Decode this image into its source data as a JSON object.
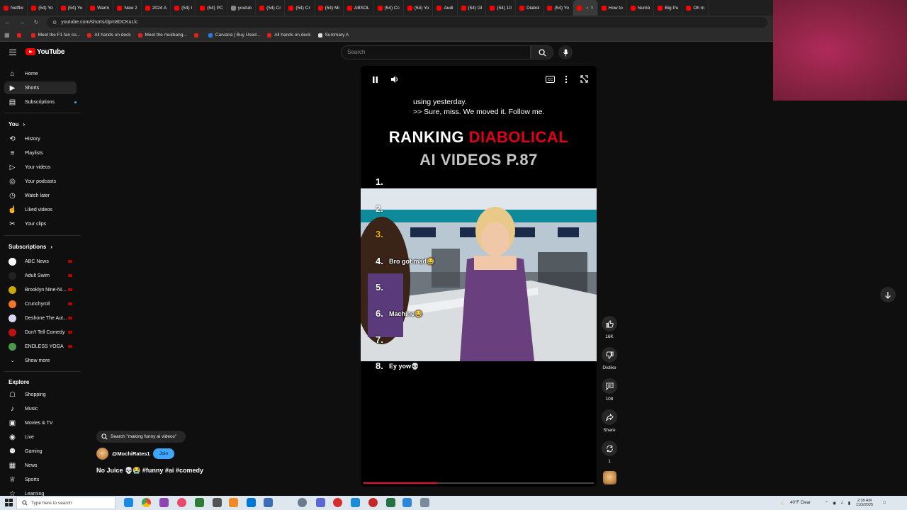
{
  "browser": {
    "tabs": [
      {
        "label": "Netflix",
        "color": "#e50914"
      },
      {
        "label": "(54) Yo",
        "color": "#ff0000"
      },
      {
        "label": "(54) Yo",
        "color": "#ff0000"
      },
      {
        "label": "Warm",
        "color": "#ff0000"
      },
      {
        "label": "New 2",
        "color": "#ff0000"
      },
      {
        "label": "2024 A",
        "color": "#ff0000"
      },
      {
        "label": "(54) I",
        "color": "#ff0000"
      },
      {
        "label": "(54) PC",
        "color": "#ff0000"
      },
      {
        "label": "youtub",
        "color": "#888888"
      },
      {
        "label": "(54) Cr",
        "color": "#ff0000"
      },
      {
        "label": "(54) Cr",
        "color": "#ff0000"
      },
      {
        "label": "(54) Mi",
        "color": "#ff0000"
      },
      {
        "label": "ABSOL",
        "color": "#ff0000"
      },
      {
        "label": "(54) Cc",
        "color": "#ff0000"
      },
      {
        "label": "(54) Yo",
        "color": "#ff0000"
      },
      {
        "label": "Audi",
        "color": "#ff0000"
      },
      {
        "label": "(54) Gl",
        "color": "#ff0000"
      },
      {
        "label": "(54) 10",
        "color": "#ff0000"
      },
      {
        "label": "Diabol",
        "color": "#ff0000"
      },
      {
        "label": "(54) Yo",
        "color": "#ff0000"
      },
      {
        "label": "",
        "color": "#ff0000",
        "active": true
      },
      {
        "label": "How to",
        "color": "#ff0000"
      },
      {
        "label": "Numb",
        "color": "#ff0000"
      },
      {
        "label": "Big Pu",
        "color": "#ff0000"
      },
      {
        "label": "Oh m",
        "color": "#ff0000"
      }
    ],
    "url": "youtube.com/shorts/dpm8DCKuLlc",
    "bookmarks": [
      {
        "label": "",
        "color": "#e62117"
      },
      {
        "label": "Meet the F1 fan co...",
        "color": "#e62117"
      },
      {
        "label": "All hands on deck",
        "color": "#e62117"
      },
      {
        "label": "Meet the mukbang...",
        "color": "#e62117"
      },
      {
        "label": "",
        "color": "#e62117"
      },
      {
        "label": "Carvana | Buy Used...",
        "color": "#2a7de1"
      },
      {
        "label": "All hands on deck",
        "color": "#e62117"
      },
      {
        "label": "Summary A",
        "color": "#dddddd"
      }
    ]
  },
  "header": {
    "logo": "YouTube",
    "search_placeholder": "Search"
  },
  "sidebar": {
    "main": [
      {
        "label": "Home",
        "icon": "home-icon"
      },
      {
        "label": "Shorts",
        "icon": "shorts-icon",
        "active": true
      },
      {
        "label": "Subscriptions",
        "icon": "subscriptions-icon"
      }
    ],
    "you_heading": "You",
    "you": [
      {
        "label": "History",
        "icon": "history-icon"
      },
      {
        "label": "Playlists",
        "icon": "playlists-icon"
      },
      {
        "label": "Your videos",
        "icon": "your-videos-icon"
      },
      {
        "label": "Your podcasts",
        "icon": "podcasts-icon"
      },
      {
        "label": "Watch later",
        "icon": "watch-later-icon"
      },
      {
        "label": "Liked videos",
        "icon": "liked-videos-icon"
      },
      {
        "label": "Your clips",
        "icon": "clips-icon"
      }
    ],
    "subs_heading": "Subscriptions",
    "subscriptions": [
      {
        "label": "ABC News",
        "color": "#ffffff"
      },
      {
        "label": "Adult Swim",
        "color": "#222222"
      },
      {
        "label": "Brooklyn Nine-Ni...",
        "color": "#c8a800"
      },
      {
        "label": "Crunchyroll",
        "color": "#f47521"
      },
      {
        "label": "Deshone The Aut...",
        "color": "#d8d8f0"
      },
      {
        "label": "Don't Tell Comedy",
        "color": "#c01010"
      },
      {
        "label": "ENDLESS YOGA",
        "color": "#4a9a4a"
      }
    ],
    "show_more": "Show more",
    "explore_heading": "Explore",
    "explore": [
      {
        "label": "Shopping",
        "icon": "shopping-bag-icon"
      },
      {
        "label": "Music",
        "icon": "music-note-icon"
      },
      {
        "label": "Movies & TV",
        "icon": "movies-icon"
      },
      {
        "label": "Live",
        "icon": "live-icon"
      },
      {
        "label": "Gaming",
        "icon": "gaming-icon"
      },
      {
        "label": "News",
        "icon": "news-icon"
      },
      {
        "label": "Sports",
        "icon": "trophy-icon"
      },
      {
        "label": "Learning",
        "icon": "learning-icon"
      }
    ]
  },
  "video": {
    "search_chip": "Search \"making funny ai videos\"",
    "channel": "@MochiRates1",
    "join_label": "Join",
    "title": "No Juice 💀😭 #funny #ai #comedy",
    "caption_line1": "using yesterday.",
    "caption_line2": ">> Sure, miss. We moved it. Follow me.",
    "overlay_title_white": "RANKING ",
    "overlay_title_red": "DIABOLICAL",
    "overlay_title_line2": "AI VIDEOS P.87",
    "ranks": [
      {
        "num": "1.",
        "label": ""
      },
      {
        "num": "2.",
        "label": ""
      },
      {
        "num": "3.",
        "label": ""
      },
      {
        "num": "4.",
        "label": "Bro got mad😂"
      },
      {
        "num": "5.",
        "label": ""
      },
      {
        "num": "6.",
        "label": "Machine😂"
      },
      {
        "num": "7.",
        "label": ""
      },
      {
        "num": "8.",
        "label": "Ey yow💀"
      }
    ],
    "progress": 0.32
  },
  "actions": {
    "likes": "16K",
    "dislike": "Dislike",
    "comments": "108",
    "share": "Share",
    "remix_count": "1"
  },
  "taskbar": {
    "search_placeholder": "Type here to search",
    "weather": "40°F  Clear",
    "time": "2:39 AM",
    "date": "11/3/2025"
  }
}
